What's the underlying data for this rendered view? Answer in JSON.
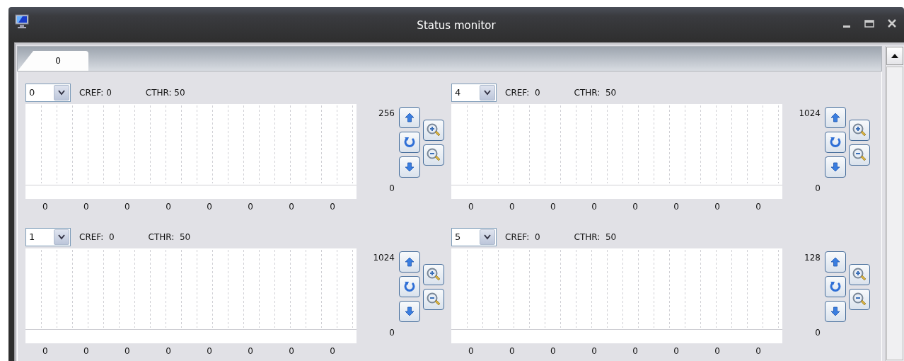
{
  "window": {
    "title": "Status monitor"
  },
  "tabs": [
    {
      "label": "0",
      "selected": true
    }
  ],
  "panels": [
    {
      "channel": "0",
      "cref": "CREF: 0",
      "cthr": "CTHR: 50",
      "y_max": "256",
      "y_min": "0",
      "x_labels": [
        "0",
        "0",
        "0",
        "0",
        "0",
        "0",
        "0",
        "0"
      ]
    },
    {
      "channel": "4",
      "cref": "CREF:  0",
      "cthr": "CTHR:  50",
      "y_max": "1024",
      "y_min": "0",
      "x_labels": [
        "0",
        "0",
        "0",
        "0",
        "0",
        "0",
        "0",
        "0"
      ]
    },
    {
      "channel": "1",
      "cref": "CREF:  0",
      "cthr": "CTHR:  50",
      "y_max": "1024",
      "y_min": "0",
      "x_labels": [
        "0",
        "0",
        "0",
        "0",
        "0",
        "0",
        "0",
        "0"
      ]
    },
    {
      "channel": "5",
      "cref": "CREF:  0",
      "cthr": "CTHR:  50",
      "y_max": "128",
      "y_min": "0",
      "x_labels": [
        "0",
        "0",
        "0",
        "0",
        "0",
        "0",
        "0",
        "0"
      ]
    }
  ]
}
